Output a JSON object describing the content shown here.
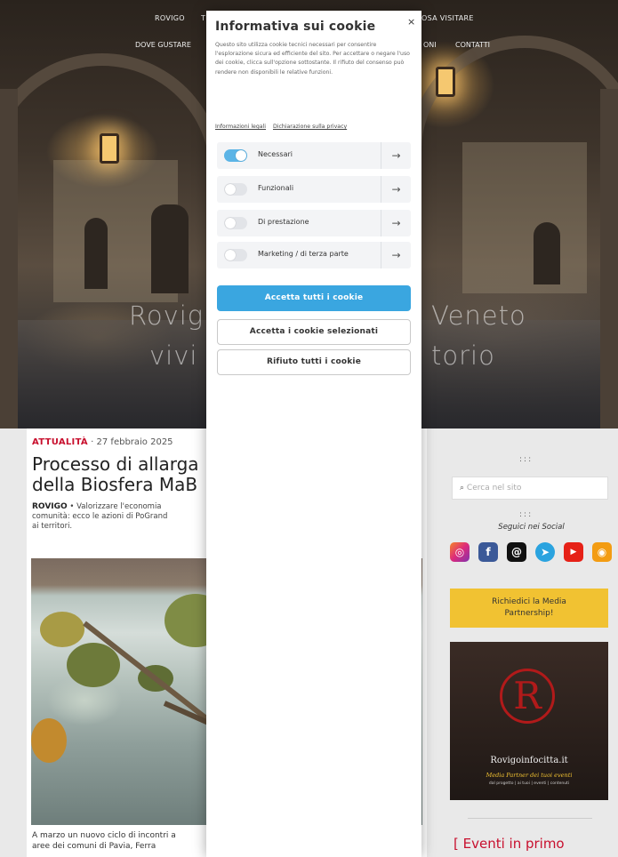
{
  "nav": {
    "top_left": "ROVIGO",
    "top_left_trunc": "T",
    "top_right": "OSA VISITARE",
    "bottom_left": "DOVE GUSTARE",
    "bottom_mid": "ONI",
    "bottom_right": "CONTATTI"
  },
  "hero": {
    "tagline_1_left": "Rovig",
    "tagline_1_right": "Veneto",
    "tagline_2_left": "vivi",
    "tagline_2_right": "torio"
  },
  "article": {
    "category": "ATTUALITÀ",
    "date": "· 27 febbraio 2025",
    "title_line1": "Processo di allarga",
    "title_line2": "della Biosfera MaB",
    "lead_place": "ROVIGO",
    "lead_text_1": " • Valorizzare l'economia",
    "lead_text_2": "comunità: ecco le azioni di PoGrand",
    "lead_text_3": "ai territori.",
    "foot_1": "A marzo un nuovo ciclo di incontri a",
    "foot_2": "aree dei comuni di Pavia, Ferra"
  },
  "sidebar": {
    "dots_top": ":::",
    "search_placeholder": "Cerca nel sito",
    "dots_mid": ":::",
    "social_title": "Seguici nei Social",
    "social_icons": [
      "instagram-icon",
      "facebook-icon",
      "threads-icon",
      "telegram-icon",
      "youtube-icon",
      "rss-icon"
    ],
    "social_glyphs": [
      "◎",
      "f",
      "@",
      "➤",
      "▶",
      "◉"
    ],
    "media_btn_1": "Richiedici la Media",
    "media_btn_2": "Partnership!",
    "banner_letter": "R",
    "banner_site": "Rovigoinfocitta.it",
    "banner_tag": "Media Partner dei tuoi eventi",
    "banner_small": "dal progetto | ai tuoi | eventi | contenuti",
    "events_title": "[ Eventi in primo"
  },
  "cookie": {
    "title": "Informativa sui cookie",
    "close": "×",
    "text": "Questo sito utilizza cookie tecnici necessari per consentire l'esplorazione sicura ed efficiente del sito. Per accettare o negare l'uso dei cookie, clicca sull'opzione sottostante. Il rifiuto del consenso può rendere non disponibili le relative funzioni.",
    "link_legal": "Informazioni legali",
    "link_privacy": "Dichiarazione sulla privacy",
    "categories": [
      {
        "label": "Necessari",
        "on": true
      },
      {
        "label": "Funzionali",
        "on": false
      },
      {
        "label": "Di prestazione",
        "on": false
      },
      {
        "label": "Marketing / di terza parte",
        "on": false
      }
    ],
    "arrow": "→",
    "btn_accept_all": "Accetta tutti i cookie",
    "btn_accept_selected": "Accetta i cookie selezionati",
    "btn_reject_all": "Rifiuto tutti i cookie"
  },
  "colors": {
    "accent_blue": "#3aa6e0",
    "brand_red": "#c8102e",
    "media_yellow": "#f1c232"
  }
}
